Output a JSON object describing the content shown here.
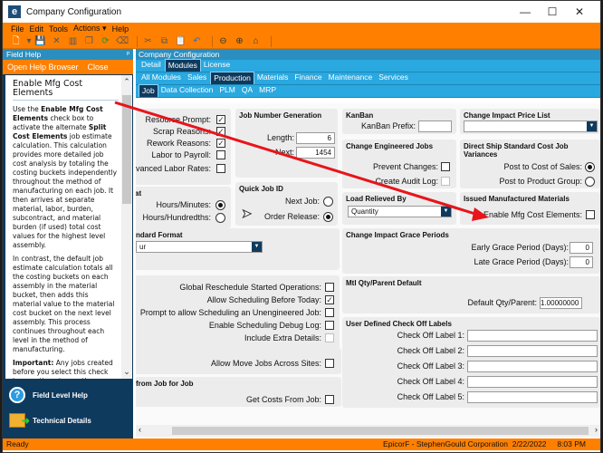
{
  "window": {
    "title": "Company Configuration",
    "app_icon_letter": "e",
    "controls": {
      "minimize": "—",
      "maximize": "☐",
      "close": "✕"
    }
  },
  "menu": [
    "File",
    "Edit",
    "Tools",
    "Actions ▾",
    "Help"
  ],
  "toolbar": {
    "icons": [
      "new-icon",
      "new-dropdown-icon",
      "save-icon",
      "delete-icon",
      "book-icon",
      "copy-icon",
      "refresh-icon",
      "eraser-icon",
      "cut-icon",
      "duplicate-icon",
      "paste-icon",
      "undo-icon",
      "back-icon",
      "forward-icon",
      "home-icon"
    ]
  },
  "field_help": {
    "title": "Field Help",
    "pin": "ᵖ",
    "links": [
      "Open Help Browser",
      "Close"
    ],
    "heading": "Enable Mfg Cost Elements",
    "p1_a": "Use the ",
    "p1_b": "Enable Mfg Cost Elements",
    "p1_c": " check box to activate the alternate ",
    "p1_d": "Split Cost Elements",
    "p1_e": " job estimate calculation. This calculation provides more detailed job cost analysis by totaling the costing buckets independently throughout the method of manufacturing on each job. It then arrives at separate material, labor, burden, subcontract, and material burden (if used) total cost values for the highest level assembly.",
    "p2": "In contrast, the default job estimate calculation totals all the costing buckets on each assembly in the material bucket, then adds this material value to the material cost bucket on the next level assembly. This process continues throughout each level in the method of manufacturing.",
    "p3_a": "Important:",
    "p3_b": " Any jobs created before you select this check box continue to use the default calculation for job estimates. Any jobs created after you select this check box use the",
    "bottom_items": [
      "Field Level Help",
      "Technical Details"
    ]
  },
  "main": {
    "title": "Company Configuration",
    "tabs1": [
      "Detail",
      "Modules",
      "License"
    ],
    "tabs1_active": "Modules",
    "tabs2": [
      "All Modules",
      "Sales",
      "Production",
      "Materials",
      "Finance",
      "Maintenance",
      "Services"
    ],
    "tabs2_active": "Production",
    "tabs3": [
      "Job",
      "Data Collection",
      "PLM",
      "QA",
      "MRP"
    ],
    "tabs3_active": "Job"
  },
  "form": {
    "general": {
      "resource_prompt": {
        "label": "Resource Prompt:",
        "checked": true
      },
      "scrap_reasons": {
        "label": "Scrap Reasons:",
        "checked": true
      },
      "rework_reasons": {
        "label": "Rework Reasons:",
        "checked": true
      },
      "labor_to_payroll": {
        "label": "Labor to Payroll:",
        "checked": false
      },
      "advanced_labor_rates": {
        "label": "Advanced Labor Rates:",
        "checked": false
      }
    },
    "time_format": {
      "title": "at",
      "hours_minutes": {
        "label": "Hours/Minutes:",
        "selected": true
      },
      "hours_hundredths": {
        "label": "Hours/Hundredths:",
        "selected": false
      }
    },
    "standard_format": {
      "title": "ndard Format",
      "value": "ur"
    },
    "job_number_generation": {
      "title": "Job Number Generation",
      "length_label": "Length:",
      "length": "6",
      "next_label": "Next:",
      "next": "1454"
    },
    "quick_job_id": {
      "title": "Quick Job ID",
      "next_job": {
        "label": "Next Job:",
        "selected": false
      },
      "order_release": {
        "label": "Order Release:",
        "selected": true
      }
    },
    "kanban": {
      "title": "KanBan",
      "prefix_label": "KanBan Prefix:",
      "prefix": ""
    },
    "change_engineered_jobs": {
      "title": "Change Engineered Jobs",
      "prevent_changes": {
        "label": "Prevent Changes:",
        "checked": false
      },
      "create_audit_log": {
        "label": "Create Audit Log:",
        "checked": false,
        "disabled": true
      }
    },
    "load_relieved_by": {
      "title": "Load Relieved By",
      "value": "Quantity"
    },
    "change_impact_price_list": {
      "title": "Change Impact Price List",
      "value": ""
    },
    "direct_ship": {
      "title": "Direct Ship Standard Cost Job Variances",
      "cost_of_sales": {
        "label": "Post to Cost of Sales:",
        "selected": true
      },
      "product_group": {
        "label": "Post to Product Group:",
        "selected": false
      }
    },
    "issued_mfg_materials": {
      "title": "Issued Manufactured Materials",
      "enable_mfg_cost_elements": {
        "label": "Enable Mfg Cost Elements:",
        "checked": false
      }
    },
    "scheduling": {
      "global_reschedule": {
        "label": "Global Reschedule Started Operations:",
        "checked": false
      },
      "allow_before_today": {
        "label": "Allow Scheduling Before Today:",
        "checked": true
      },
      "prompt_unengineered": {
        "label": "Prompt to allow Scheduling an Unengineered Job:",
        "checked": false
      },
      "debug_log": {
        "label": "Enable Scheduling Debug Log:",
        "checked": false
      },
      "extra_details": {
        "label": "Include Extra Details:",
        "checked": false,
        "disabled": true
      }
    },
    "move_jobs": {
      "label": "Allow Move Jobs Across Sites:",
      "checked": false
    },
    "costs_from_job": {
      "title": "from Job for Job",
      "label": "Get Costs From Job:",
      "checked": false
    },
    "grace_periods": {
      "title": "Change Impact Grace Periods",
      "early_label": "Early Grace Period (Days):",
      "early": "0",
      "late_label": "Late Grace Period (Days):",
      "late": "0"
    },
    "mtl_qty": {
      "title": "Mtl Qty/Parent Default",
      "label": "Default Qty/Parent:",
      "value": "1.00000000"
    },
    "check_off_labels": {
      "title": "User Defined Check Off Labels",
      "items": [
        {
          "label": "Check Off Label 1:",
          "value": ""
        },
        {
          "label": "Check Off Label 2:",
          "value": ""
        },
        {
          "label": "Check Off Label 3:",
          "value": ""
        },
        {
          "label": "Check Off Label 4:",
          "value": ""
        },
        {
          "label": "Check Off Label 5:",
          "value": ""
        }
      ]
    }
  },
  "status": {
    "left": "Ready",
    "right": "EpicorF - StephenGould Corporation  2/22/2022     8:03 PM"
  },
  "annotation": {
    "color": "#e8141a"
  }
}
